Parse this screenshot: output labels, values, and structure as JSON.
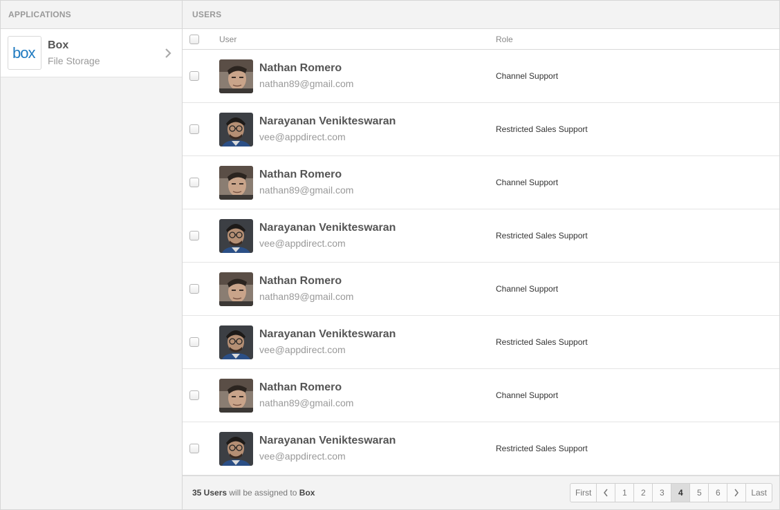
{
  "applications": {
    "header": "APPLICATIONS",
    "items": [
      {
        "name": "Box",
        "subtitle": "File Storage",
        "logo_text": "box",
        "logo_color": "#1f7ac0"
      }
    ]
  },
  "users": {
    "header": "USERS",
    "columns": {
      "user": "User",
      "role": "Role"
    },
    "rows": [
      {
        "name": "Nathan Romero",
        "email": "nathan89@gmail.com",
        "role": "Channel Support",
        "avatar": "nathan"
      },
      {
        "name": "Narayanan Venikteswaran",
        "email": "vee@appdirect.com",
        "role": "Restricted Sales Support",
        "avatar": "narayanan"
      },
      {
        "name": "Nathan Romero",
        "email": "nathan89@gmail.com",
        "role": "Channel Support",
        "avatar": "nathan"
      },
      {
        "name": "Narayanan Venikteswaran",
        "email": "vee@appdirect.com",
        "role": "Restricted Sales Support",
        "avatar": "narayanan"
      },
      {
        "name": "Nathan Romero",
        "email": "nathan89@gmail.com",
        "role": "Channel Support",
        "avatar": "nathan"
      },
      {
        "name": "Narayanan Venikteswaran",
        "email": "vee@appdirect.com",
        "role": "Restricted Sales Support",
        "avatar": "narayanan"
      },
      {
        "name": "Nathan Romero",
        "email": "nathan89@gmail.com",
        "role": "Channel Support",
        "avatar": "nathan"
      },
      {
        "name": "Narayanan Venikteswaran",
        "email": "vee@appdirect.com",
        "role": "Restricted Sales Support",
        "avatar": "narayanan"
      }
    ]
  },
  "footer": {
    "count": "35 Users",
    "middle": " will be assigned to ",
    "app": "Box"
  },
  "pagination": {
    "first": "First",
    "last": "Last",
    "pages": [
      "1",
      "2",
      "3",
      "4",
      "5",
      "6"
    ],
    "current": "4"
  }
}
